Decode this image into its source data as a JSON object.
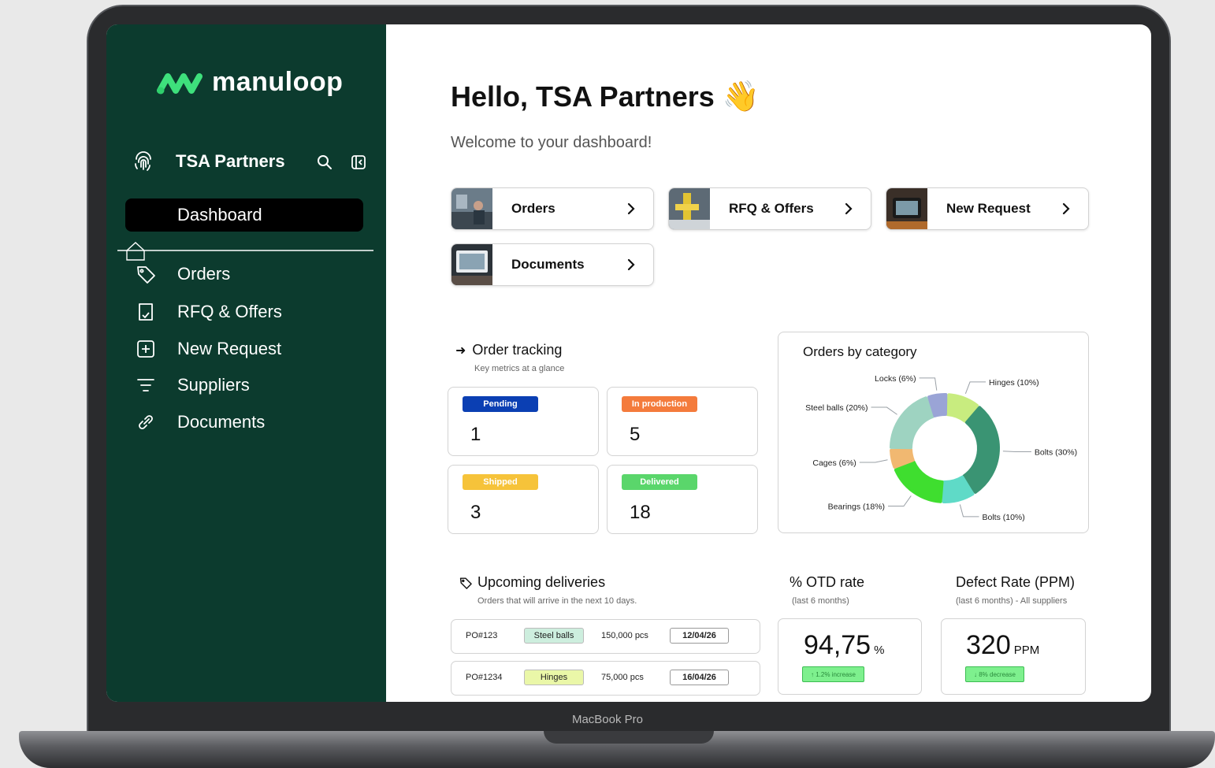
{
  "device": {
    "label": "MacBook Pro"
  },
  "brand": {
    "name": "manuloop"
  },
  "account": {
    "name": "TSA Partners"
  },
  "nav": {
    "active": "Dashboard",
    "items": [
      {
        "label": "Orders",
        "icon": "tag-icon"
      },
      {
        "label": "RFQ & Offers",
        "icon": "document-check-icon"
      },
      {
        "label": "New Request",
        "icon": "plus-square-icon"
      },
      {
        "label": "Suppliers",
        "icon": "filter-icon"
      },
      {
        "label": "Documents",
        "icon": "link-icon"
      }
    ]
  },
  "header": {
    "greeting": "Hello, TSA Partners",
    "wave": "👋",
    "subtitle": "Welcome to your dashboard!"
  },
  "quick_links": [
    {
      "label": "Orders"
    },
    {
      "label": "RFQ & Offers"
    },
    {
      "label": "New Request"
    },
    {
      "label": "Documents"
    }
  ],
  "order_tracking": {
    "title": "Order tracking",
    "subtitle": "Key metrics at a glance",
    "metrics": [
      {
        "label": "Pending",
        "value": "1",
        "color": "#0b3fb3"
      },
      {
        "label": "In production",
        "value": "5",
        "color": "#f47b3c"
      },
      {
        "label": "Shipped",
        "value": "3",
        "color": "#f6c33a"
      },
      {
        "label": "Delivered",
        "value": "18",
        "color": "#5ad66b"
      }
    ]
  },
  "chart_data": {
    "type": "pie",
    "title": "Orders by category",
    "slices": [
      {
        "label": "Hinges (10%)",
        "value": 10,
        "color": "#c8ec7f"
      },
      {
        "label": "Bolts (30%)",
        "value": 30,
        "color": "#3a9473"
      },
      {
        "label": "Bolts (10%)",
        "value": 10,
        "color": "#5fdac7"
      },
      {
        "label": "Bearings (18%)",
        "value": 18,
        "color": "#3fde2f"
      },
      {
        "label": "Cages (6%)",
        "value": 6,
        "color": "#f1b871"
      },
      {
        "label": "Steel balls (20%)",
        "value": 20,
        "color": "#9ed3c1"
      },
      {
        "label": "Locks (6%)",
        "value": 6,
        "color": "#9aa4d6"
      }
    ]
  },
  "deliveries": {
    "title": "Upcoming deliveries",
    "subtitle": "Orders that will arrive in the next 10 days.",
    "rows": [
      {
        "po": "PO#123",
        "category": "Steel balls",
        "category_color": "#cdeede",
        "qty": "150,000 pcs",
        "date": "12/04/26"
      },
      {
        "po": "PO#1234",
        "category": "Hinges",
        "category_color": "#eaf7a8",
        "qty": "75,000 pcs",
        "date": "16/04/26"
      }
    ]
  },
  "otd": {
    "title": "% OTD rate",
    "subtitle": "(last 6 months)",
    "value": "94,75",
    "unit": "%",
    "trend": "↑ 1.2% increase"
  },
  "defect": {
    "title": "Defect Rate (PPM)",
    "subtitle": "(last 6 months) - All suppliers",
    "value": "320",
    "unit": "PPM",
    "trend": "↓ 8% decrease"
  }
}
